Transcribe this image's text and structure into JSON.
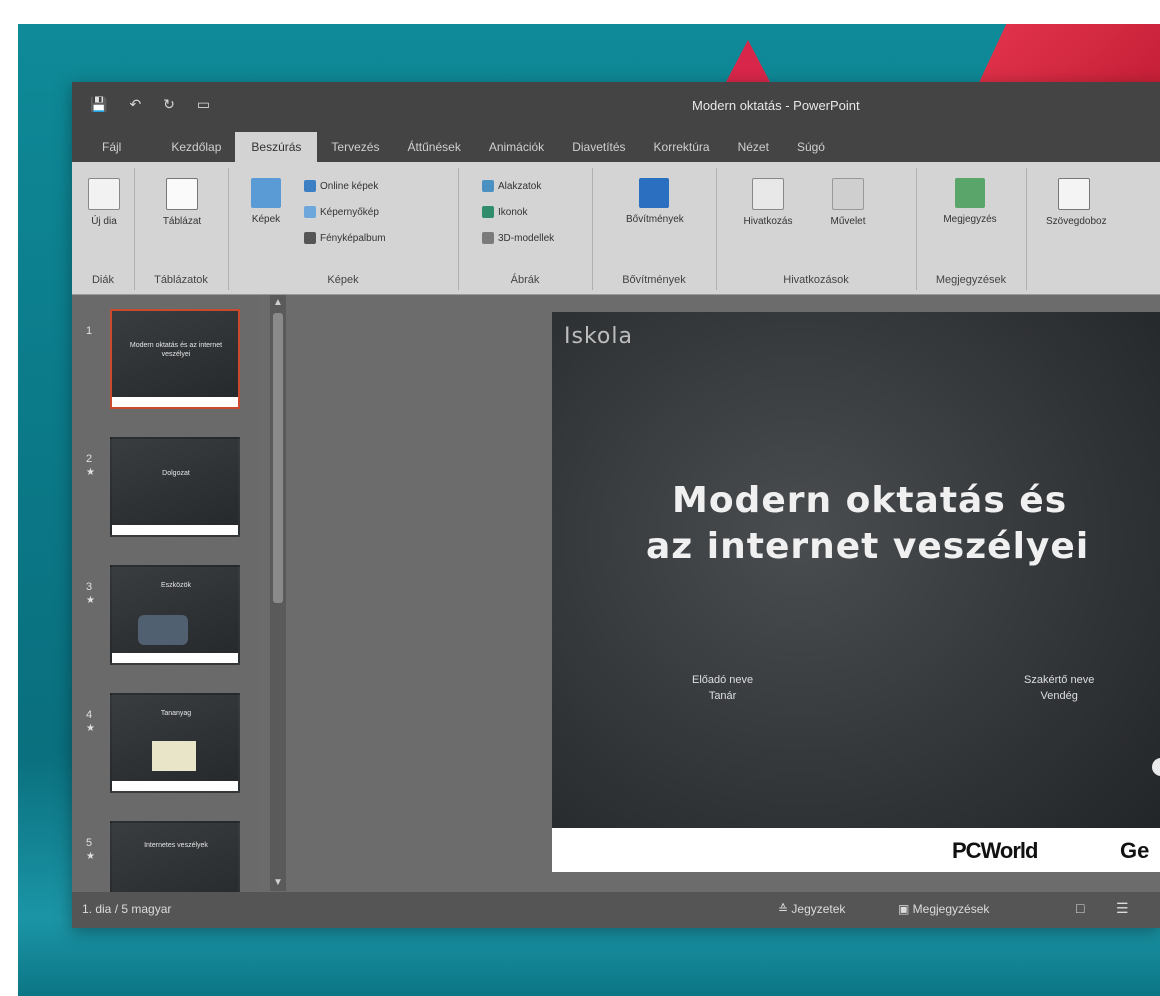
{
  "window": {
    "title": "Modern oktatás - PowerPoint"
  },
  "qat": {
    "icons": [
      "save-icon",
      "undo-icon",
      "redo-icon",
      "present-icon"
    ]
  },
  "tabs": [
    "Fájl",
    "Kezdőlap",
    "Beszúrás",
    "Tervezés",
    "Áttűnések",
    "Animációk",
    "Diavetítés",
    "Korrektúra",
    "Nézet",
    "Súgó"
  ],
  "ribbon": {
    "groups": [
      {
        "label": "Diák"
      },
      {
        "label": "Táblázatok"
      },
      {
        "label": "Képek"
      },
      {
        "label": "Ábrák"
      },
      {
        "label": "Bővítmények"
      },
      {
        "label": "Hivatkozások"
      },
      {
        "label": "Megjegyzések"
      }
    ],
    "buttons": {
      "new_slide": "Új dia",
      "table": "Táblázat",
      "pictures": "Képek",
      "online_pictures": "Online képek",
      "screenshot": "Képernyőkép",
      "photo_album": "Fényképalbum",
      "shapes": "Alakzatok",
      "icons": "Ikonok",
      "3d_models": "3D-modellek",
      "addins": "Bővítmények",
      "link": "Hivatkozás",
      "action": "Művelet",
      "comment": "Megjegyzés",
      "text_box": "Szövegdoboz"
    }
  },
  "thumbnails": [
    {
      "num": "1",
      "text": "Modern oktatás és az internet veszélyei",
      "selected": true
    },
    {
      "num": "2",
      "text": "Dolgozat",
      "selected": false
    },
    {
      "num": "3",
      "text": "Eszközök",
      "selected": false
    },
    {
      "num": "4",
      "text": "Tananyag",
      "selected": false
    },
    {
      "num": "5",
      "text": "Internetes veszélyek",
      "selected": false
    }
  ],
  "slide": {
    "header": "Iskola",
    "title_line1": "Modern oktatás és",
    "title_line2": "az internet veszélyei",
    "author_left_line1": "Előadó neve",
    "author_left_line2": "Tanár",
    "author_right_line1": "Szakértő neve",
    "author_right_line2": "Vendég",
    "footer_brand": "PCWorld",
    "footer_brand2": "Ge"
  },
  "status": {
    "left": "1. dia / 5   magyar",
    "notes": "Jegyzetek",
    "comments": "Megjegyzések",
    "view_normal": "□",
    "view_sorter": "☰"
  }
}
